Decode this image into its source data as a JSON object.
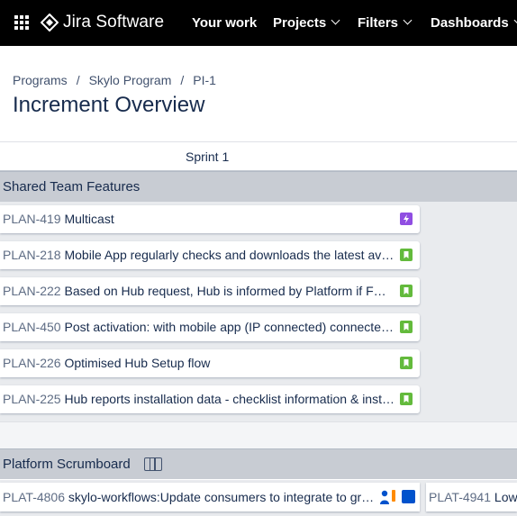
{
  "header": {
    "app_name": "Jira Software",
    "nav": [
      {
        "label": "Your work",
        "dropdown": false
      },
      {
        "label": "Projects",
        "dropdown": true
      },
      {
        "label": "Filters",
        "dropdown": true
      },
      {
        "label": "Dashboards",
        "dropdown": true
      }
    ]
  },
  "breadcrumbs": [
    {
      "label": "Programs"
    },
    {
      "label": "Skylo Program"
    },
    {
      "label": "PI-1"
    }
  ],
  "breadcrumb_separator": "/",
  "page_title": "Increment Overview",
  "sprint_header": "Sprint 1",
  "shared_group": {
    "label": "Shared Team Features",
    "cards": [
      {
        "key": "PLAN-419",
        "summary": "Multicast",
        "type_icon": "epic-lightning-icon"
      },
      {
        "key": "PLAN-218",
        "summary": "Mobile App regularly checks and downloads the latest av…",
        "type_icon": "story-bookmark-icon"
      },
      {
        "key": "PLAN-222",
        "summary": "Based on Hub request, Hub is informed by Platform if F…",
        "type_icon": "story-bookmark-icon"
      },
      {
        "key": "PLAN-450",
        "summary": "Post activation: with mobile app (IP connected) connecte…",
        "type_icon": "story-bookmark-icon"
      },
      {
        "key": "PLAN-226",
        "summary": "Optimised Hub Setup flow",
        "type_icon": "story-bookmark-icon"
      },
      {
        "key": "PLAN-225",
        "summary": "Hub reports installation data - checklist information & inst…",
        "type_icon": "story-bookmark-icon"
      }
    ]
  },
  "platform_group": {
    "label": "Platform Scrumboard",
    "cards": [
      {
        "key": "PLAT-4806",
        "summary": "skylo-workflows:Update consumers to integrate to gr…"
      },
      {
        "key": "PLAT-4941",
        "summary": "Low"
      }
    ]
  },
  "colors": {
    "topbar": "#000000",
    "story": "#63ba3c",
    "epic": "#904ee2",
    "group_header": "#c8ccd3",
    "text": "#172b4d",
    "key_text": "#5e6c84"
  }
}
